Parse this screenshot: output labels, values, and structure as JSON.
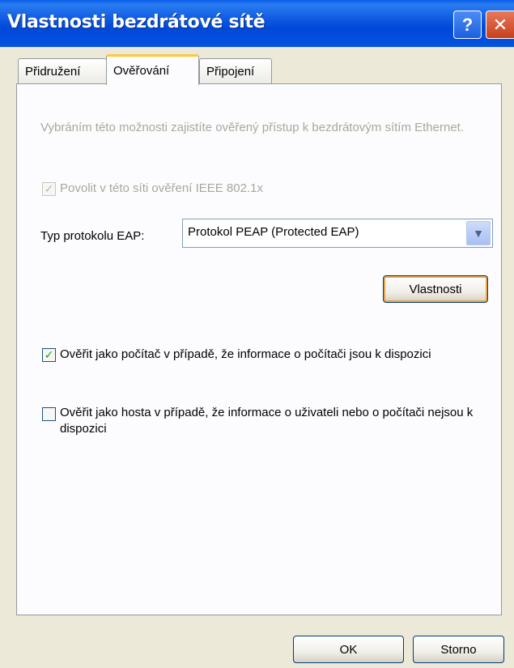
{
  "window": {
    "title": "Vlastnosti bezdrátové sítě",
    "help_label": "?",
    "close_label": "✕"
  },
  "tabs": [
    {
      "label": "Přidružení",
      "active": false
    },
    {
      "label": "Ověřování",
      "active": true
    },
    {
      "label": "Připojení",
      "active": false
    }
  ],
  "auth": {
    "description": "Vybráním této možnosti zajistíte ověřený přístup k bezdrátovým sítím Ethernet.",
    "ieee_checkbox_label": "Povolit v této síti ověření IEEE 802.1x",
    "ieee_checked": true,
    "eap_label": "Typ protokolu EAP:",
    "eap_value": "Protokol PEAP (Protected EAP)",
    "properties_button": "Vlastnosti",
    "computer_checkbox_label": "Ověřit jako počítač v případě, že informace o počítači jsou k dispozici",
    "computer_checked": true,
    "guest_checkbox_label": "Ověřit jako hosta v případě, že informace o uživateli nebo o počítači nejsou k dispozici",
    "guest_checked": false
  },
  "footer": {
    "ok_label": "OK",
    "cancel_label": "Storno"
  }
}
